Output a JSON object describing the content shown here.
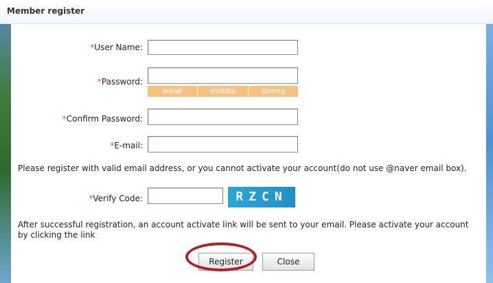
{
  "window": {
    "title": "Member register"
  },
  "form": {
    "required_mark": "*",
    "username": {
      "label": "User Name:",
      "value": ""
    },
    "password": {
      "label": "Password:",
      "value": ""
    },
    "strength": {
      "weak": "weak",
      "middle": "middle",
      "strong": "strong"
    },
    "confirm": {
      "label": "Confirm Password:",
      "value": ""
    },
    "email": {
      "label": "E-mail:",
      "value": ""
    },
    "email_note": "Please register with valid email address, or you cannot activate your account(do not use @naver email box).",
    "verify": {
      "label": "Verify Code:",
      "value": "",
      "captcha_text": "RZCN"
    },
    "activation_note": "After successful registration, an account activate link will be sent to your email. Please activate your account by clicking the link"
  },
  "buttons": {
    "register": "Register",
    "close": "Close"
  },
  "colors": {
    "required": "#e05a2b",
    "strength_bar": "#f7c27f",
    "captcha_bg": "#1f8fc6",
    "highlight_ring": "#b51e26"
  }
}
